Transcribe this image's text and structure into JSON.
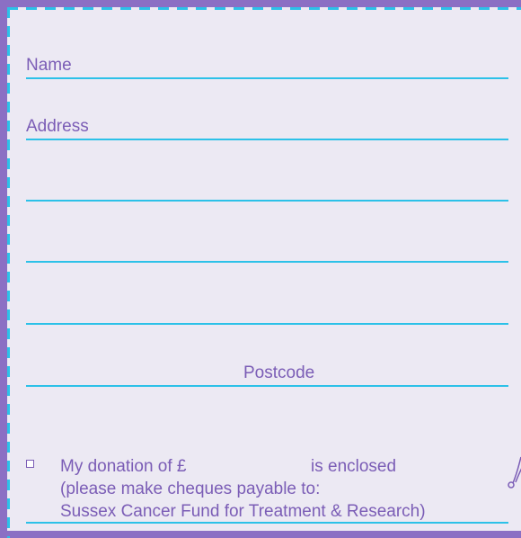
{
  "form": {
    "name_label": "Name",
    "address_label": "Address",
    "postcode_label": "Postcode",
    "donation": {
      "prefix": "My donation of £",
      "suffix": "is enclosed",
      "instruction_line1": "(please make cheques payable to:",
      "instruction_line2": "Sussex Cancer Fund for Treatment & Research)"
    }
  },
  "colors": {
    "background": "#ece9f3",
    "border_purple": "#8b6fc4",
    "rule_cyan": "#2cc1e8",
    "text_purple": "#7b5db6"
  },
  "icons": [
    "scissors-icon",
    "checkbox-icon"
  ]
}
